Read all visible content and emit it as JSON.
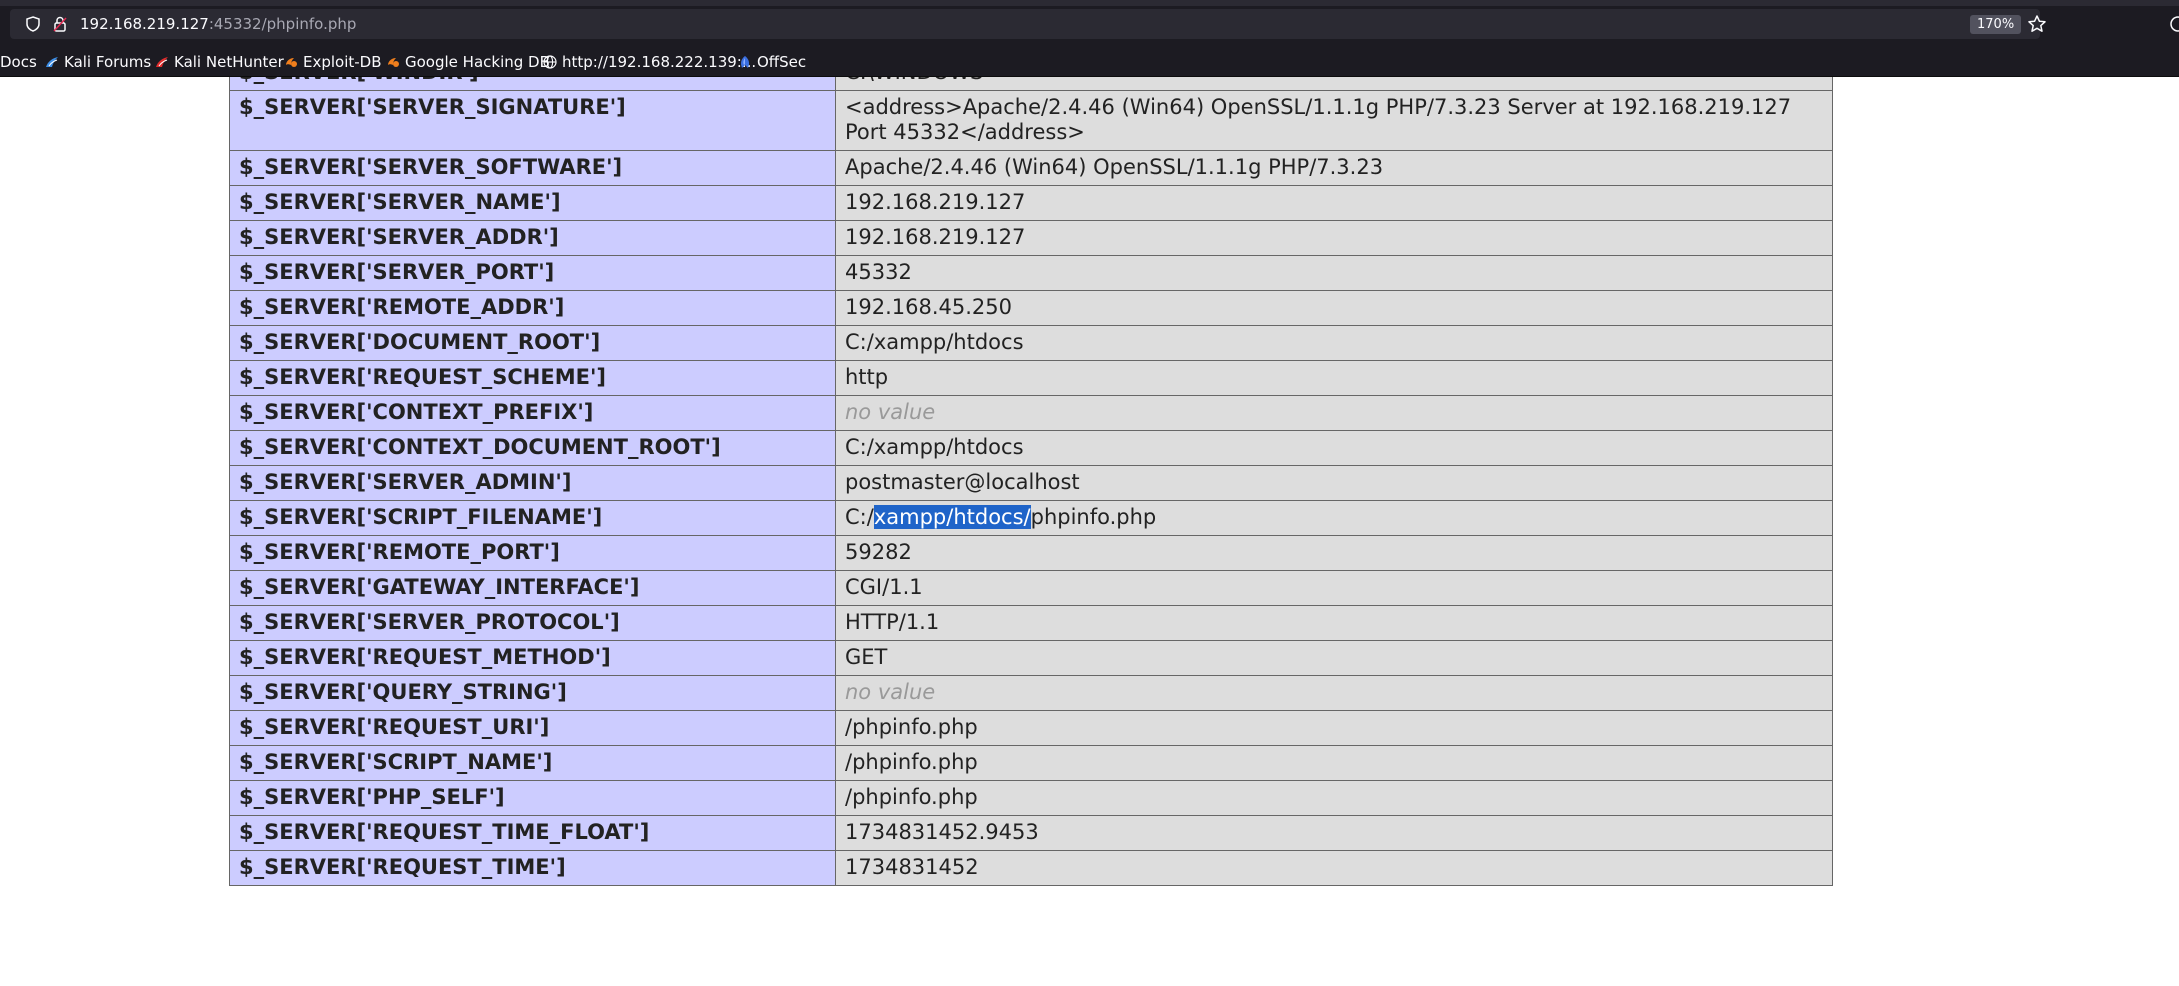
{
  "browser": {
    "url_host": "192.168.219.127",
    "url_rest": ":45332/phpinfo.php",
    "zoom": "170%"
  },
  "bookmarks": [
    {
      "label": "Docs",
      "icon": "none"
    },
    {
      "label": "Kali Forums",
      "icon": "kali-dragon-icon"
    },
    {
      "label": "Kali NetHunter",
      "icon": "nethunter-icon"
    },
    {
      "label": "Exploit-DB",
      "icon": "exploit-db-icon"
    },
    {
      "label": "Google Hacking DB",
      "icon": "ghdb-icon"
    },
    {
      "label": "http://192.168.222.139:...",
      "icon": "globe-icon"
    },
    {
      "label": "OffSec",
      "icon": "offsec-icon"
    }
  ],
  "rows": [
    {
      "key": "$_SERVER['WINDIR']",
      "value": "C:\\WINDOWS"
    },
    {
      "key": "$_SERVER['SERVER_SIGNATURE']",
      "value": "<address>Apache/2.4.46 (Win64) OpenSSL/1.1.1g PHP/7.3.23 Server at 192.168.219.127 Port 45332</address>"
    },
    {
      "key": "$_SERVER['SERVER_SOFTWARE']",
      "value": "Apache/2.4.46 (Win64) OpenSSL/1.1.1g PHP/7.3.23"
    },
    {
      "key": "$_SERVER['SERVER_NAME']",
      "value": "192.168.219.127"
    },
    {
      "key": "$_SERVER['SERVER_ADDR']",
      "value": "192.168.219.127"
    },
    {
      "key": "$_SERVER['SERVER_PORT']",
      "value": "45332"
    },
    {
      "key": "$_SERVER['REMOTE_ADDR']",
      "value": "192.168.45.250"
    },
    {
      "key": "$_SERVER['DOCUMENT_ROOT']",
      "value": "C:/xampp/htdocs"
    },
    {
      "key": "$_SERVER['REQUEST_SCHEME']",
      "value": "http"
    },
    {
      "key": "$_SERVER['CONTEXT_PREFIX']",
      "value": "no value",
      "novalue": true
    },
    {
      "key": "$_SERVER['CONTEXT_DOCUMENT_ROOT']",
      "value": "C:/xampp/htdocs"
    },
    {
      "key": "$_SERVER['SERVER_ADMIN']",
      "value": "postmaster@localhost"
    },
    {
      "key": "$_SERVER['SCRIPT_FILENAME']",
      "value_parts": [
        "C:/",
        "xampp/htdocs/",
        "phpinfo.php"
      ],
      "selected_part": 1
    },
    {
      "key": "$_SERVER['REMOTE_PORT']",
      "value": "59282"
    },
    {
      "key": "$_SERVER['GATEWAY_INTERFACE']",
      "value": "CGI/1.1"
    },
    {
      "key": "$_SERVER['SERVER_PROTOCOL']",
      "value": "HTTP/1.1"
    },
    {
      "key": "$_SERVER['REQUEST_METHOD']",
      "value": "GET"
    },
    {
      "key": "$_SERVER['QUERY_STRING']",
      "value": "no value",
      "novalue": true
    },
    {
      "key": "$_SERVER['REQUEST_URI']",
      "value": "/phpinfo.php"
    },
    {
      "key": "$_SERVER['SCRIPT_NAME']",
      "value": "/phpinfo.php"
    },
    {
      "key": "$_SERVER['PHP_SELF']",
      "value": "/phpinfo.php"
    },
    {
      "key": "$_SERVER['REQUEST_TIME_FLOAT']",
      "value": "1734831452.9453"
    },
    {
      "key": "$_SERVER['REQUEST_TIME']",
      "value": "1734831452"
    }
  ],
  "colors": {
    "key_bg": "#ccccff",
    "value_bg": "#dddddd",
    "selection": "#1f64c9",
    "no_value": "#999999"
  }
}
